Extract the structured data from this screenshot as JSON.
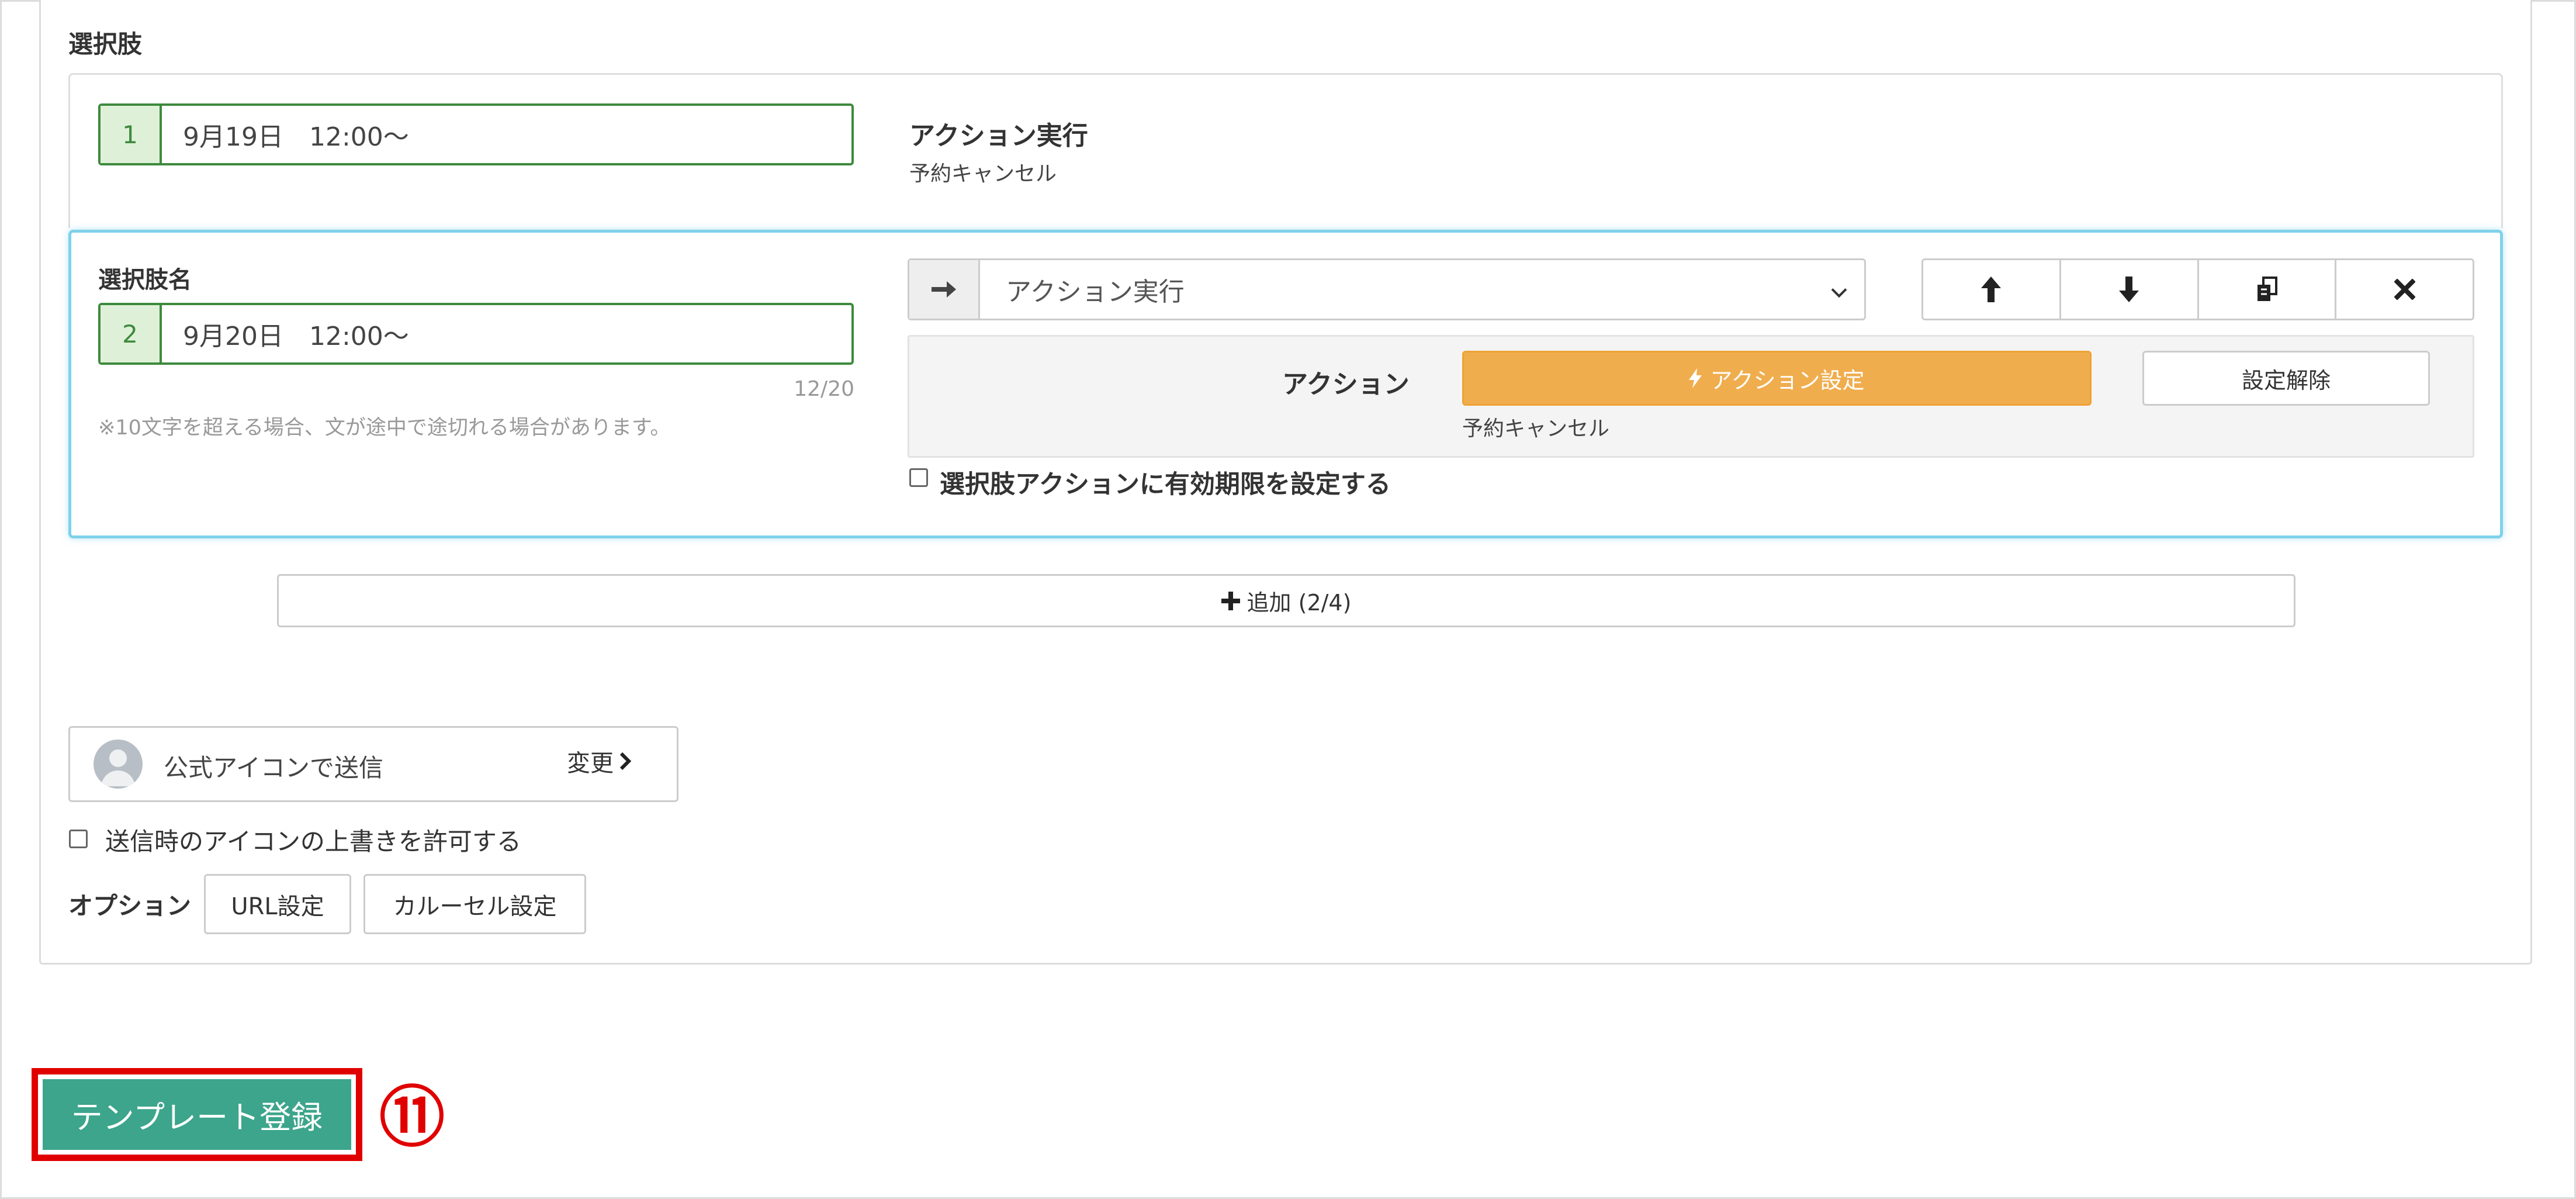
{
  "colors": {
    "accent_green": "#3d8a3d",
    "number_bg": "#dff0d8",
    "focus_blue": "#7fd1ea",
    "orange": "#f0ad4e",
    "submit_teal": "#3ca58b",
    "highlight_red": "#e00000"
  },
  "choices": {
    "section_label": "選択肢",
    "item1": {
      "number": "1",
      "value": "9月19日　12:00～",
      "action_title": "アクション実行",
      "action_detail": "予約キャンセル"
    },
    "item2": {
      "name_label": "選択肢名",
      "number": "2",
      "value": "9月20日　12:00～",
      "char_count": "12/20",
      "note": "※10文字を超える場合、文が途中で途切れる場合があります。",
      "select_value": "アクション実行",
      "move_buttons": [
        "arrow-up-icon",
        "arrow-down-icon",
        "copy-icon",
        "close-icon"
      ],
      "action_label": "アクション",
      "action_set_button": "アクション設定",
      "action_clear_button": "設定解除",
      "action_detail": "予約キャンセル",
      "expiry_checkbox_label": "選択肢アクションに有効期限を設定する",
      "expiry_checked": false
    },
    "add_button": "追加 (2/4)"
  },
  "sender": {
    "label": "公式アイコンで送信",
    "change_button": "変更",
    "override_checkbox_label": "送信時のアイコンの上書きを許可する",
    "override_checked": false
  },
  "options": {
    "label": "オプション",
    "buttons": [
      "URL設定",
      "カルーセル設定"
    ]
  },
  "submit": {
    "label": "テンプレート登録",
    "marker": "⑪"
  }
}
